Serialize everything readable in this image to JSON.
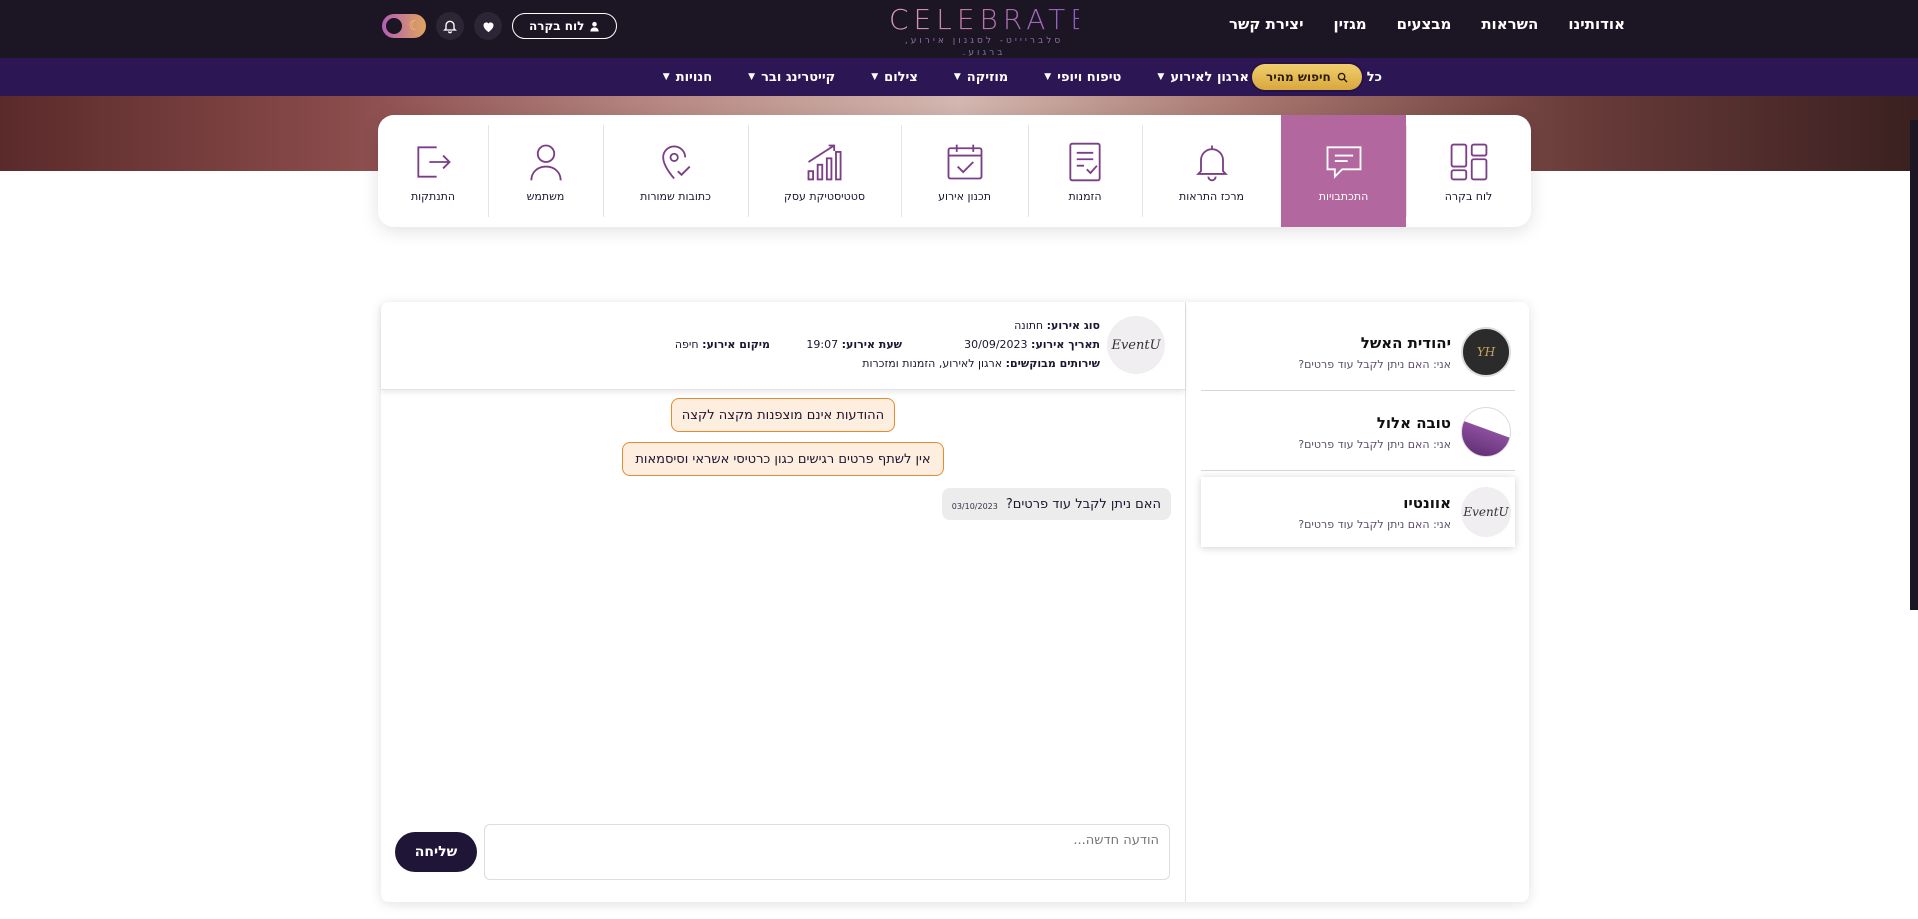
{
  "header": {
    "nav": [
      "אודותינו",
      "השראות",
      "מבצעים",
      "מגזין",
      "יצירת קשר"
    ],
    "logo_word": "CELEBRATE",
    "logo_tagline": "סלבריייט- לסגנון אירוע, ברגוע.",
    "dashboard_button": "לוח בקרה",
    "icons": [
      "moon-icon",
      "bell-icon",
      "heart-icon",
      "user-icon"
    ]
  },
  "categories": {
    "items": [
      {
        "label": "כל נותני השירות",
        "has_menu": false
      },
      {
        "label": "ארגון לאירוע",
        "has_menu": true
      },
      {
        "label": "טיפוח ויופי",
        "has_menu": true
      },
      {
        "label": "מוזיקה",
        "has_menu": true
      },
      {
        "label": "צילום",
        "has_menu": true
      },
      {
        "label": "קייטרינג ובר",
        "has_menu": true
      },
      {
        "label": "חנויות",
        "has_menu": true
      }
    ],
    "quick_search": "חיפוש מהיר"
  },
  "dashboard": {
    "items": [
      {
        "label": "לוח בקרה",
        "icon": "dashboard-icon",
        "active": false
      },
      {
        "label": "התכתבויות",
        "icon": "chat-icon",
        "active": true
      },
      {
        "label": "מרכז התראות",
        "icon": "bell-icon",
        "active": false
      },
      {
        "label": "הזמנות",
        "icon": "orders-icon",
        "active": false
      },
      {
        "label": "תכנון אירוע",
        "icon": "calendar-icon",
        "active": false
      },
      {
        "label": "סטטיסטיקת עסק",
        "icon": "stats-icon",
        "active": false
      },
      {
        "label": "כתובות שמורות",
        "icon": "location-icon",
        "active": false
      },
      {
        "label": "משתמש",
        "icon": "user-icon",
        "active": false
      },
      {
        "label": "התנתקות",
        "icon": "logout-icon",
        "active": false
      }
    ]
  },
  "conversations": [
    {
      "name": "יהודית האשל",
      "preview": "אני: האם ניתן לקבל עוד פרטים?",
      "avatar_text": "YH",
      "selected": false
    },
    {
      "name": "טובה אלול",
      "preview": "אני: האם ניתן לקבל עוד פרטים?",
      "avatar_text": "",
      "selected": false
    },
    {
      "name": "אוונטיו",
      "preview": "אני: האם ניתן לקבל עוד פרטים?",
      "avatar_text": "EventU",
      "selected": true
    }
  ],
  "thread": {
    "avatar_text": "EventU",
    "event_type_label": "סוג אירוע:",
    "event_type": "חתונה",
    "event_date_label": "תאריך אירוע:",
    "event_date": "30/09/2023",
    "event_time_label": "שעת אירוע:",
    "event_time": "19:07",
    "event_location_label": "מיקום אירוע:",
    "event_location": "חיפה",
    "services_label": "שירותים מבוקשים:",
    "services": "ארגון לאירוע, הזמנות ומזכרות",
    "notices": [
      "ההודעות אינם מוצפנות מקצה לקצה",
      "אין לשתף פרטים רגישים כגון כרטיסי אשראי וסיסמאות"
    ],
    "messages": [
      {
        "text": "האם ניתן לקבל עוד פרטים?",
        "date": "03/10/2023"
      }
    ],
    "compose_placeholder": "הודעה חדשה...",
    "send_label": "שליחה"
  }
}
